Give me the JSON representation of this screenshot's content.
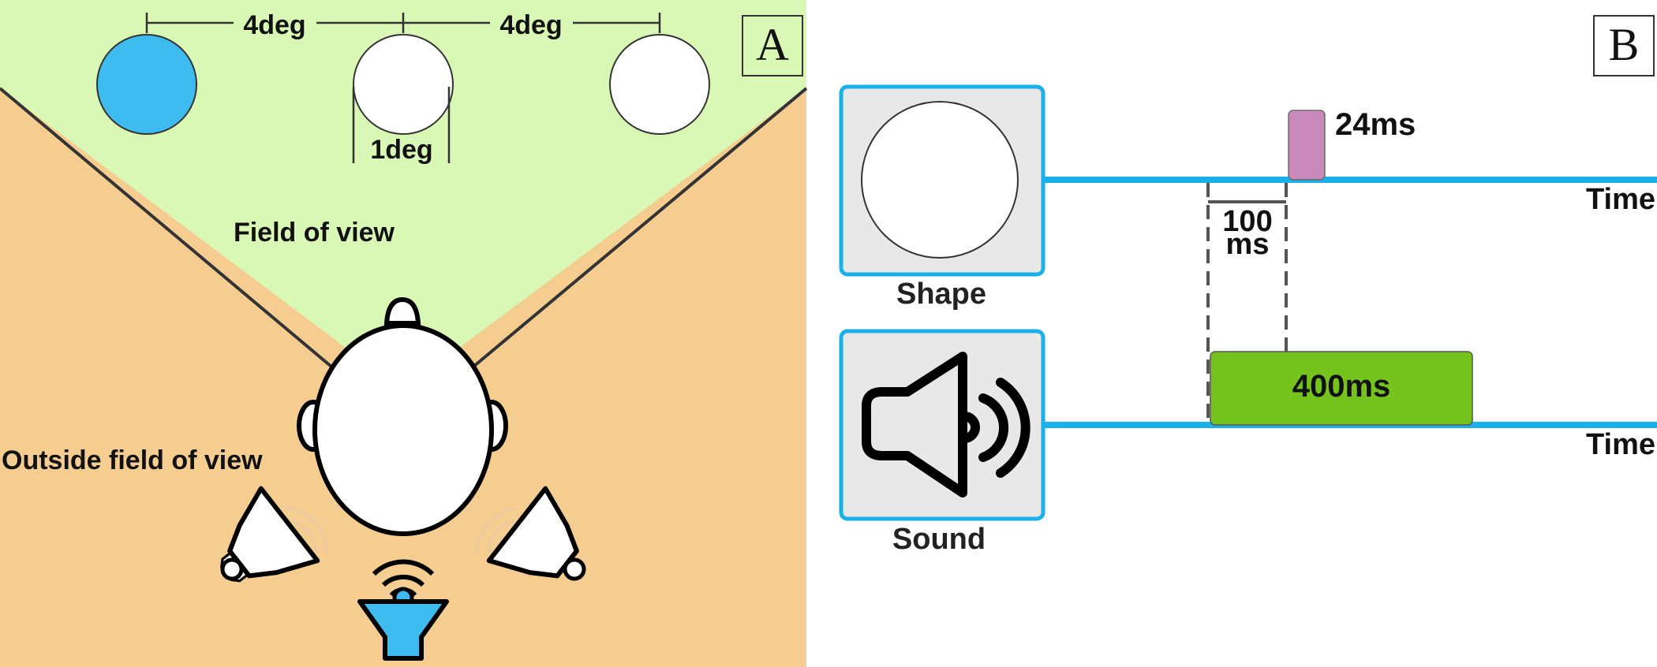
{
  "panel_a": {
    "letter": "A",
    "spacing_left_label": "4deg",
    "spacing_right_label": "4deg",
    "size_label": "1deg",
    "field_label": "Field of view",
    "outside_label": "Outside field of view"
  },
  "panel_b": {
    "letter": "B",
    "shape_caption": "Shape",
    "sound_caption": "Sound",
    "flash_duration": "24ms",
    "offset_value": "100",
    "offset_unit": "ms",
    "sound_duration": "400ms",
    "time_label_top": "Time",
    "time_label_bottom": "Time"
  },
  "colors": {
    "field_green": "#d9f7b5",
    "outside_orange": "#f5cd90",
    "target_blue": "#3fbcef",
    "timeline_blue": "#1ab0ea",
    "flash_pink": "#c78ab9",
    "sound_green": "#77c31e",
    "stimulus_gray": "#e8e8e8"
  }
}
